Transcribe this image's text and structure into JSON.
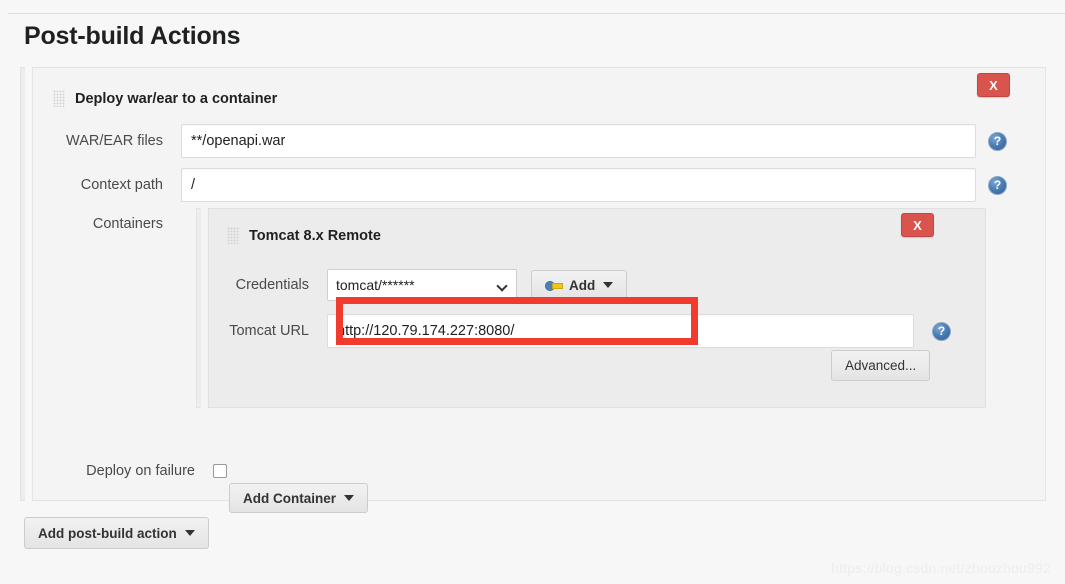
{
  "page": {
    "title": "Post-build Actions",
    "watermark": "https://blog.csdn.net/zhouzhou992"
  },
  "deploy_section": {
    "heading": "Deploy war/ear to a container",
    "remove_label": "X",
    "fields": {
      "war_files": {
        "label": "WAR/EAR files",
        "value": "**/openapi.war",
        "help_label": "?"
      },
      "context_path": {
        "label": "Context path",
        "value": "/",
        "help_label": "?"
      },
      "containers": {
        "label": "Containers"
      },
      "deploy_on_failure": {
        "label": "Deploy on failure",
        "checked": false
      }
    },
    "add_container_label": "Add Container"
  },
  "container": {
    "heading": "Tomcat 8.x Remote",
    "remove_label": "X",
    "credentials": {
      "label": "Credentials",
      "selected": "tomcat/******",
      "options": [
        "tomcat/******"
      ],
      "add_label": "Add"
    },
    "tomcat_url": {
      "label": "Tomcat URL",
      "value": "http://120.79.174.227:8080/",
      "help_label": "?"
    },
    "advanced_label": "Advanced..."
  },
  "footer": {
    "add_post_build_action_label": "Add post-build action"
  },
  "colors": {
    "danger": "#d9544d",
    "annotation": "#f23b2f",
    "help_blue": "#4a7fb5"
  }
}
